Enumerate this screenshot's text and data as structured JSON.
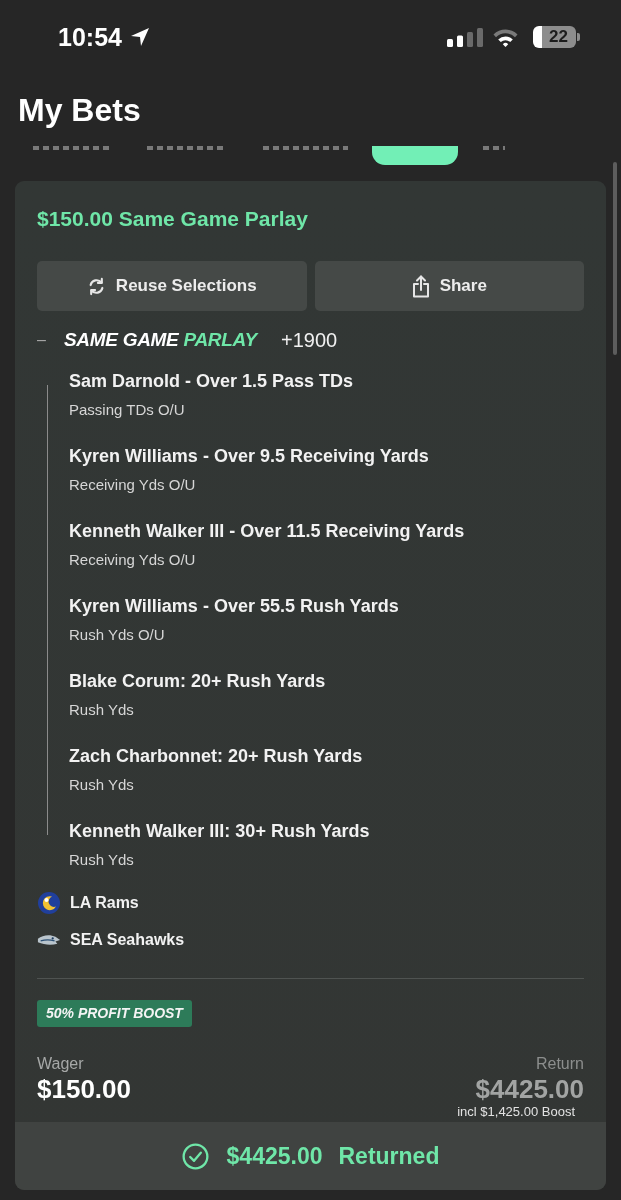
{
  "status_bar": {
    "time": "10:54",
    "battery": "22"
  },
  "header": {
    "title": "My Bets"
  },
  "tabs": [
    {
      "selected": false
    },
    {
      "selected": false
    },
    {
      "selected": false
    },
    {
      "selected": true
    },
    {
      "selected": false
    }
  ],
  "bet": {
    "title": "$150.00 Same Game Parlay",
    "actions": [
      {
        "kind": "reuse",
        "label": "Reuse Selections"
      },
      {
        "kind": "share",
        "label": "Share"
      }
    ],
    "parlay": {
      "toggle": "–",
      "brand": "SAME GAME",
      "brand_accent": "PARLAY",
      "odds": "+1900"
    },
    "legs": [
      {
        "selection": "Sam Darnold - Over 1.5 Pass TDs",
        "market": "Passing TDs O/U"
      },
      {
        "selection": "Kyren Williams - Over 9.5 Receiving Yards",
        "market": "Receiving Yds O/U"
      },
      {
        "selection": "Kenneth Walker III - Over 11.5 Receiving Yards",
        "market": "Receiving Yds O/U"
      },
      {
        "selection": "Kyren Williams - Over 55.5 Rush Yards",
        "market": "Rush Yds O/U"
      },
      {
        "selection": "Blake Corum: 20+ Rush Yards",
        "market": "Rush Yds"
      },
      {
        "selection": "Zach Charbonnet: 20+ Rush Yards",
        "market": "Rush Yds"
      },
      {
        "selection": "Kenneth Walker III: 30+ Rush Yards",
        "market": "Rush Yds"
      }
    ],
    "teams": [
      {
        "kind": "rams",
        "name": "LA Rams"
      },
      {
        "kind": "seahawks",
        "name": "SEA Seahawks"
      }
    ],
    "boost_badge": "50% PROFIT BOOST",
    "wager": {
      "label": "Wager",
      "amount": "$150.00"
    },
    "return": {
      "label": "Return",
      "amount": "$4425.00",
      "note": "incl $1,425.00 Boost"
    },
    "result": {
      "amount": "$4425.00",
      "status": "Returned"
    }
  }
}
